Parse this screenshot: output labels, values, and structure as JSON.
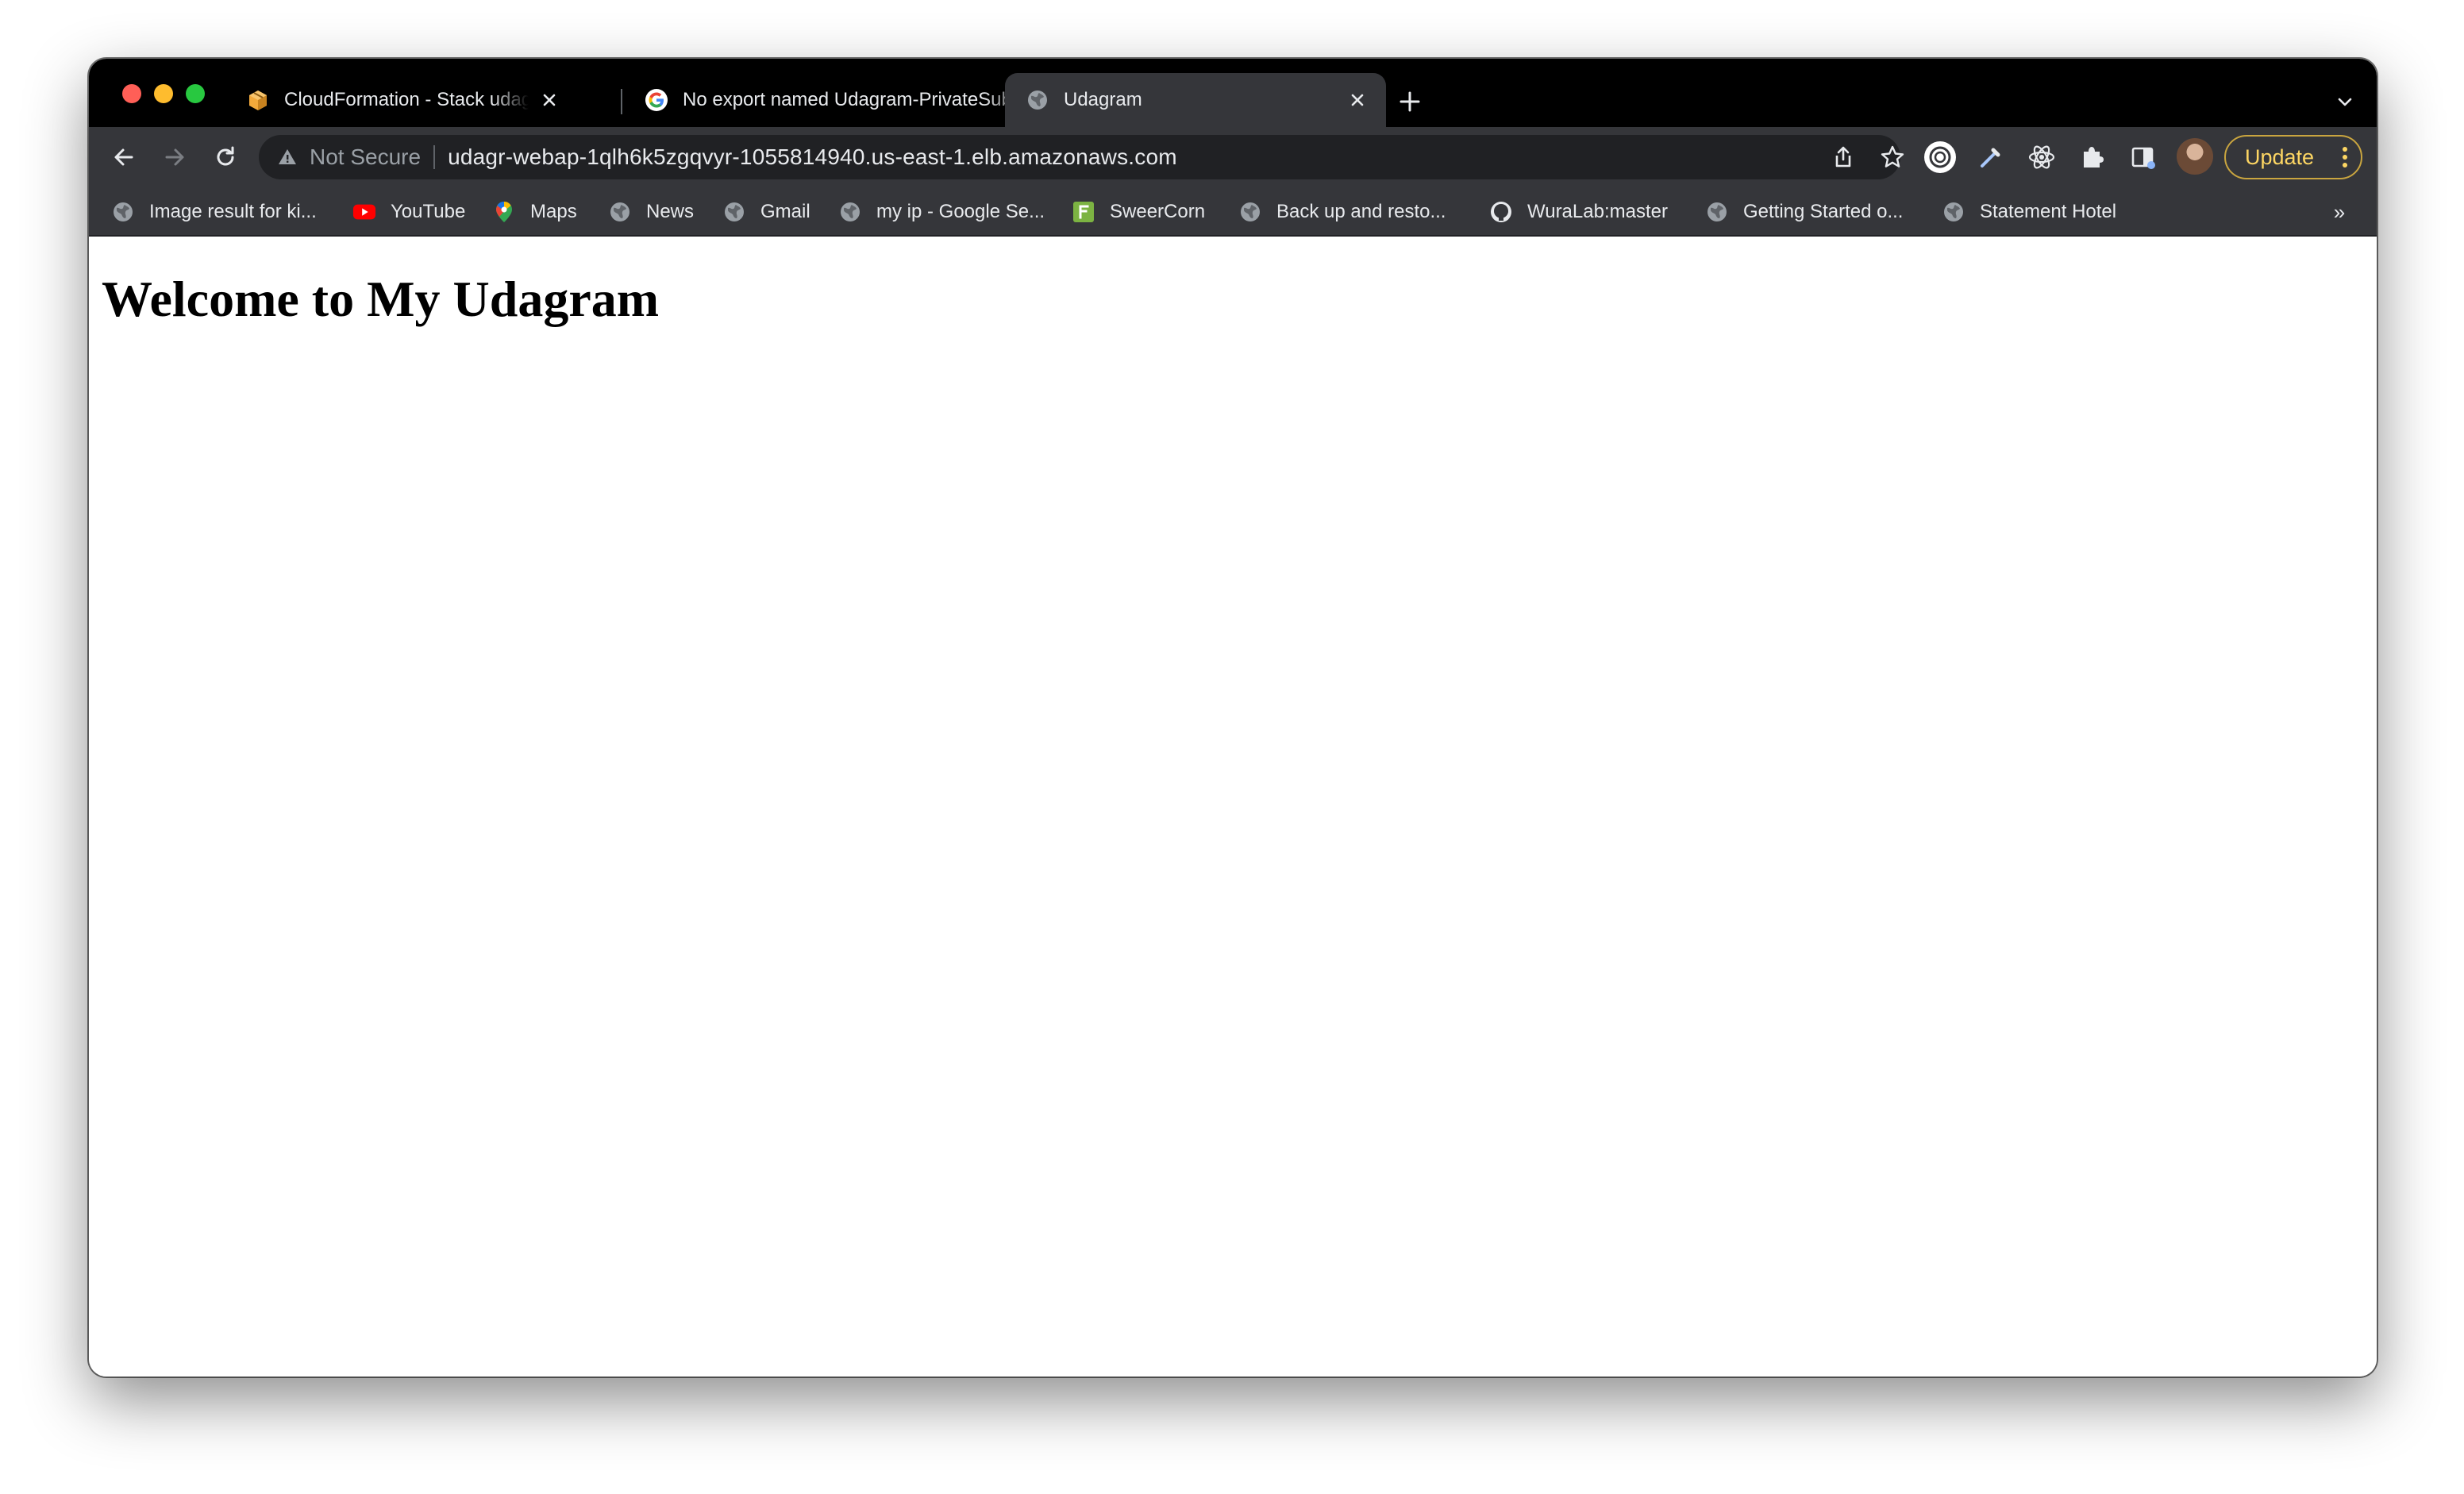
{
  "tabs": [
    {
      "title": "CloudFormation - Stack udagram",
      "favicon": "aws-cube-icon",
      "active": false
    },
    {
      "title": "No export named Udagram-PrivateSubnets",
      "favicon": "google-g-icon",
      "active": false
    },
    {
      "title": "Udagram",
      "favicon": "globe-icon",
      "active": true
    }
  ],
  "omnibox": {
    "security_label": "Not Secure",
    "url": "udagr-webap-1qlh6k5zgqvyr-1055814940.us-east-1.elb.amazonaws.com"
  },
  "toolbar": {
    "update_label": "Update"
  },
  "bookmarks": [
    {
      "label": "Image result for ki...",
      "icon": "globe-icon"
    },
    {
      "label": "YouTube",
      "icon": "youtube-icon"
    },
    {
      "label": "Maps",
      "icon": "maps-pin-icon"
    },
    {
      "label": "News",
      "icon": "globe-icon"
    },
    {
      "label": "Gmail",
      "icon": "globe-icon"
    },
    {
      "label": "my ip - Google Se...",
      "icon": "globe-icon"
    },
    {
      "label": "SweerCorn",
      "icon": "green-f-icon"
    },
    {
      "label": "Back up and resto...",
      "icon": "globe-icon"
    },
    {
      "label": "WuraLab:master",
      "icon": "github-icon"
    },
    {
      "label": "Getting Started o...",
      "icon": "globe-icon"
    },
    {
      "label": "Statement Hotel",
      "icon": "globe-icon"
    }
  ],
  "bookmarks_overflow": "»",
  "page": {
    "heading": "Welcome to My Udagram"
  },
  "colors": {
    "tabstrip_bg": "#000000",
    "toolbar_bg": "#35363a",
    "omnibox_bg": "#202124",
    "update_accent": "#fdd663"
  }
}
